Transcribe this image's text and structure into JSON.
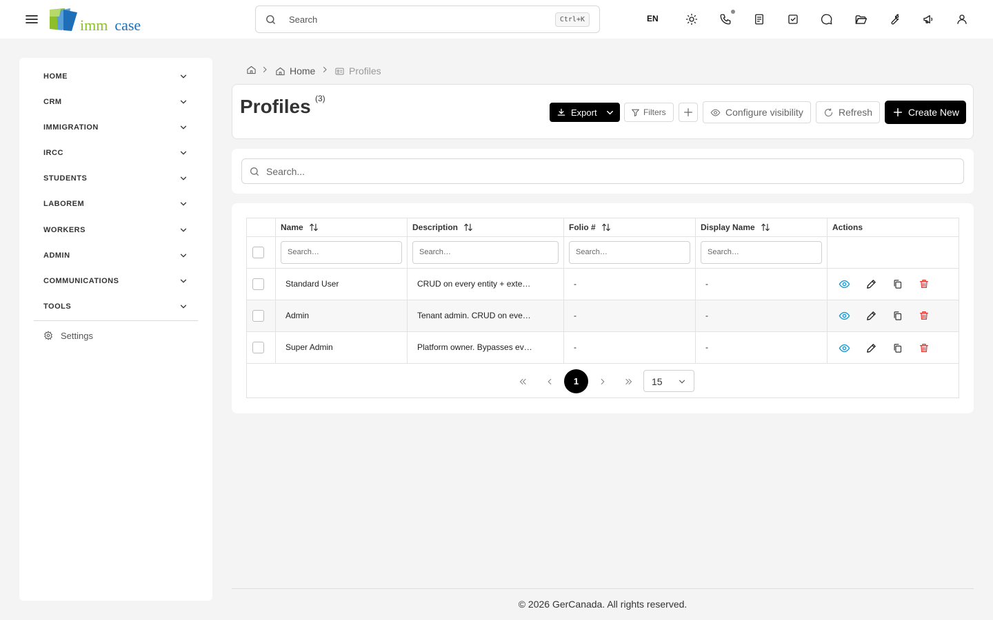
{
  "header": {
    "logo": {
      "word1": "imm",
      "word2": "case"
    },
    "search": {
      "placeholder": "Search",
      "shortcut": "Ctrl+K"
    },
    "language": "EN",
    "icons": [
      "sun-icon",
      "phone-icon",
      "notes-icon",
      "task-check-icon",
      "chat-icon",
      "folder-icon",
      "wrench-icon",
      "megaphone-icon",
      "user-icon"
    ]
  },
  "sidebar": {
    "items": [
      {
        "label": "HOME"
      },
      {
        "label": "CRM"
      },
      {
        "label": "IMMIGRATION"
      },
      {
        "label": "IRCC"
      },
      {
        "label": "STUDENTS"
      },
      {
        "label": "LABOREM"
      },
      {
        "label": "WORKERS"
      },
      {
        "label": "ADMIN"
      },
      {
        "label": "COMMUNICATIONS"
      },
      {
        "label": "TOOLS"
      }
    ],
    "settings_label": "Settings"
  },
  "breadcrumb": {
    "home": "Home",
    "current": "Profiles"
  },
  "page": {
    "title": "Profiles",
    "count": "(3)",
    "toolbar": {
      "export": "Export",
      "filters": "Filters",
      "configure_visibility": "Configure visibility",
      "refresh": "Refresh",
      "create_new": "Create New"
    },
    "search_placeholder": "Search..."
  },
  "table": {
    "columns": [
      {
        "label": "Name"
      },
      {
        "label": "Description"
      },
      {
        "label": "Folio #"
      },
      {
        "label": "Display Name"
      },
      {
        "label": "Actions"
      }
    ],
    "filter_placeholder": "Search…",
    "rows": [
      {
        "name": "Standard User",
        "description": "CRUD on every entity + exte…",
        "folio": "-",
        "display_name": "-"
      },
      {
        "name": "Admin",
        "description": "Tenant admin. CRUD on eve…",
        "folio": "-",
        "display_name": "-"
      },
      {
        "name": "Super Admin",
        "description": "Platform owner. Bypasses ev…",
        "folio": "-",
        "display_name": "-"
      }
    ],
    "pagination": {
      "current_page": "1",
      "page_size": "15"
    }
  },
  "footer": {
    "text": "© 2026 GerCanada. All rights reserved."
  },
  "colors": {
    "accent": "#000000",
    "view_icon": "#1a9bd7",
    "delete_icon": "#e53935",
    "logo_green": "#8cbf2a",
    "logo_blue": "#1e6fb8"
  }
}
